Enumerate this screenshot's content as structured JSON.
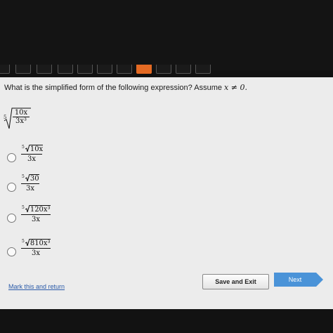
{
  "question": {
    "prompt": "What is the simplified form of the following expression? Assume",
    "condition": "x ≠ 0.",
    "expression": {
      "index": "5",
      "numerator": "10x",
      "denominator": "3x³"
    }
  },
  "options": [
    {
      "index": "5",
      "radicand": "10x",
      "denominator": "3x"
    },
    {
      "index": "5",
      "radicand": "30",
      "denominator": "3x"
    },
    {
      "index": "5",
      "radicand": "120x³",
      "denominator": "3x"
    },
    {
      "index": "5",
      "radicand": "810x³",
      "denominator": "3x"
    }
  ],
  "footer": {
    "mark_link": "Mark this and return",
    "save_exit": "Save and Exit",
    "next": "Next"
  },
  "colors": {
    "current_question": "#e46a23",
    "next_button": "#4a93d8",
    "link": "#2a5aa8"
  }
}
